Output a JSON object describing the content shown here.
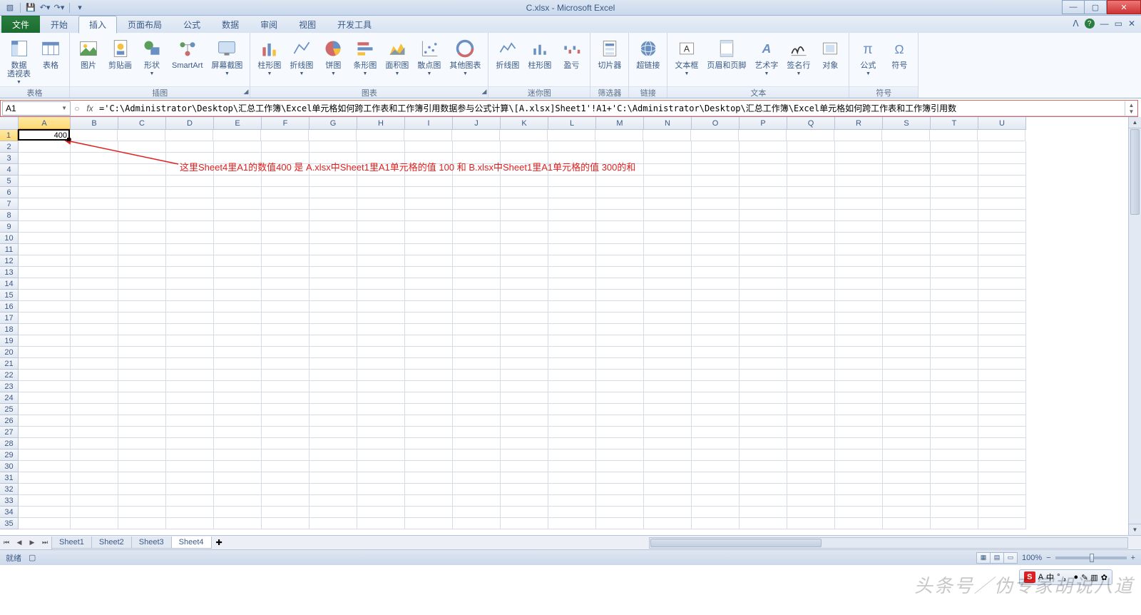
{
  "window": {
    "title": "C.xlsx - Microsoft Excel"
  },
  "qat": {
    "save": "save",
    "undo": "undo",
    "redo": "redo"
  },
  "tabs": {
    "file": "文件",
    "items": [
      "开始",
      "插入",
      "页面布局",
      "公式",
      "数据",
      "审阅",
      "视图",
      "开发工具"
    ],
    "active_index": 1,
    "help": "?"
  },
  "ribbon": {
    "groups": [
      {
        "label": "表格",
        "buttons": [
          {
            "name": "pivot-table",
            "label": "数据\n透视表",
            "dd": true
          },
          {
            "name": "table",
            "label": "表格"
          }
        ]
      },
      {
        "label": "插图",
        "launcher": true,
        "buttons": [
          {
            "name": "picture",
            "label": "图片"
          },
          {
            "name": "clipart",
            "label": "剪贴画"
          },
          {
            "name": "shapes",
            "label": "形状",
            "dd": true
          },
          {
            "name": "smartart",
            "label": "SmartArt"
          },
          {
            "name": "screenshot",
            "label": "屏幕截图",
            "dd": true
          }
        ]
      },
      {
        "label": "图表",
        "launcher": true,
        "buttons": [
          {
            "name": "column-chart",
            "label": "柱形图",
            "dd": true
          },
          {
            "name": "line-chart",
            "label": "折线图",
            "dd": true
          },
          {
            "name": "pie-chart",
            "label": "饼图",
            "dd": true
          },
          {
            "name": "bar-chart",
            "label": "条形图",
            "dd": true
          },
          {
            "name": "area-chart",
            "label": "面积图",
            "dd": true
          },
          {
            "name": "scatter-chart",
            "label": "散点图",
            "dd": true
          },
          {
            "name": "other-chart",
            "label": "其他图表",
            "dd": true
          }
        ]
      },
      {
        "label": "迷你图",
        "buttons": [
          {
            "name": "sparkline-line",
            "label": "折线图"
          },
          {
            "name": "sparkline-column",
            "label": "柱形图"
          },
          {
            "name": "sparkline-winloss",
            "label": "盈亏"
          }
        ]
      },
      {
        "label": "筛选器",
        "buttons": [
          {
            "name": "slicer",
            "label": "切片器"
          }
        ]
      },
      {
        "label": "链接",
        "buttons": [
          {
            "name": "hyperlink",
            "label": "超链接"
          }
        ]
      },
      {
        "label": "文本",
        "buttons": [
          {
            "name": "textbox",
            "label": "文本框",
            "dd": true
          },
          {
            "name": "header-footer",
            "label": "页眉和页脚"
          },
          {
            "name": "wordart",
            "label": "艺术字",
            "dd": true
          },
          {
            "name": "signature",
            "label": "签名行",
            "dd": true
          },
          {
            "name": "object",
            "label": "对象"
          }
        ]
      },
      {
        "label": "符号",
        "buttons": [
          {
            "name": "equation",
            "label": "公式",
            "dd": true
          },
          {
            "name": "symbol",
            "label": "符号"
          }
        ]
      }
    ]
  },
  "formula_bar": {
    "name_box": "A1",
    "fx": "fx",
    "formula": "='C:\\Administrator\\Desktop\\汇总工作簿\\Excel单元格如何跨工作表和工作簿引用数据参与公式计算\\[A.xlsx]Sheet1'!A1+'C:\\Administrator\\Desktop\\汇总工作簿\\Excel单元格如何跨工作表和工作簿引用数"
  },
  "grid": {
    "columns": [
      "A",
      "B",
      "C",
      "D",
      "E",
      "F",
      "G",
      "H",
      "I",
      "J",
      "K",
      "L",
      "M",
      "N",
      "O",
      "P",
      "Q",
      "R",
      "S",
      "T",
      "U"
    ],
    "active_col": 0,
    "rows": 35,
    "active_row": 1,
    "cell_A1": "400"
  },
  "annotation": {
    "text": "这里Sheet4里A1的数值400  是   A.xlsx中Sheet1里A1单元格的值 100 和 B.xlsx中Sheet1里A1单元格的值 300的和"
  },
  "sheets": {
    "tabs": [
      "Sheet1",
      "Sheet2",
      "Sheet3",
      "Sheet4"
    ],
    "active_index": 3
  },
  "status": {
    "ready": "就绪",
    "zoom": "100%",
    "minus": "−",
    "plus": "+"
  },
  "watermark": "头条号／伪专家胡说八道",
  "ime": {
    "s": "S",
    "items": [
      "A",
      "中",
      "°",
      "，",
      "●",
      "✎",
      "▥",
      "✿"
    ]
  }
}
